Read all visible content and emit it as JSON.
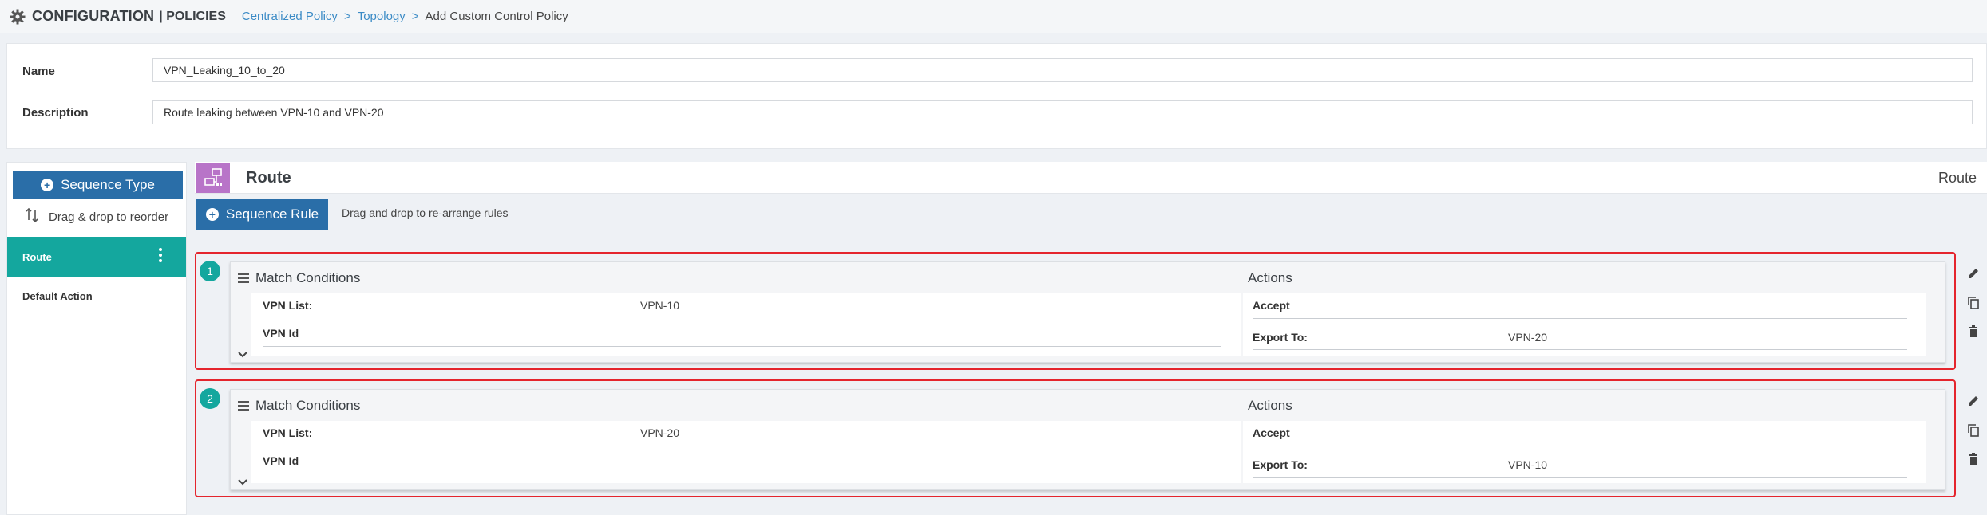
{
  "header": {
    "app_title": "CONFIGURATION",
    "section": "| POLICIES",
    "breadcrumb": {
      "link1": "Centralized Policy",
      "link2": "Topology",
      "arrow": ">",
      "current": "Add Custom Control Policy"
    }
  },
  "form": {
    "name_label": "Name",
    "name_value": "VPN_Leaking_10_to_20",
    "description_label": "Description",
    "description_value": "Route leaking between VPN-10 and VPN-20"
  },
  "left_panel": {
    "sequence_type_label": "Sequence Type",
    "drag_hint": "Drag & drop to reorder",
    "items": [
      {
        "label": "Route",
        "active": true
      },
      {
        "label": "Default Action",
        "active": false
      }
    ]
  },
  "route_header": {
    "title": "Route",
    "right_label": "Route",
    "icon": "route-policy-icon"
  },
  "sequence_rule": {
    "button_label": "Sequence Rule",
    "hint": "Drag and drop to re-arrange rules"
  },
  "rules": [
    {
      "number": "1",
      "match_title": "Match Conditions",
      "actions_title": "Actions",
      "vpn_list_label": "VPN List:",
      "vpn_list_value": "VPN-10",
      "vpn_id_label": "VPN Id",
      "accept_label": "Accept",
      "export_label": "Export To:",
      "export_value": "VPN-20"
    },
    {
      "number": "2",
      "match_title": "Match Conditions",
      "actions_title": "Actions",
      "vpn_list_label": "VPN List:",
      "vpn_list_value": "VPN-20",
      "vpn_id_label": "VPN Id",
      "accept_label": "Accept",
      "export_label": "Export To:",
      "export_value": "VPN-10"
    }
  ],
  "colors": {
    "primary_button": "#2a6ea8",
    "active_teal": "#14a79e",
    "highlight_red": "#e4252d",
    "link_blue": "#3b8bc6",
    "route_icon_bg": "#b874c8"
  }
}
